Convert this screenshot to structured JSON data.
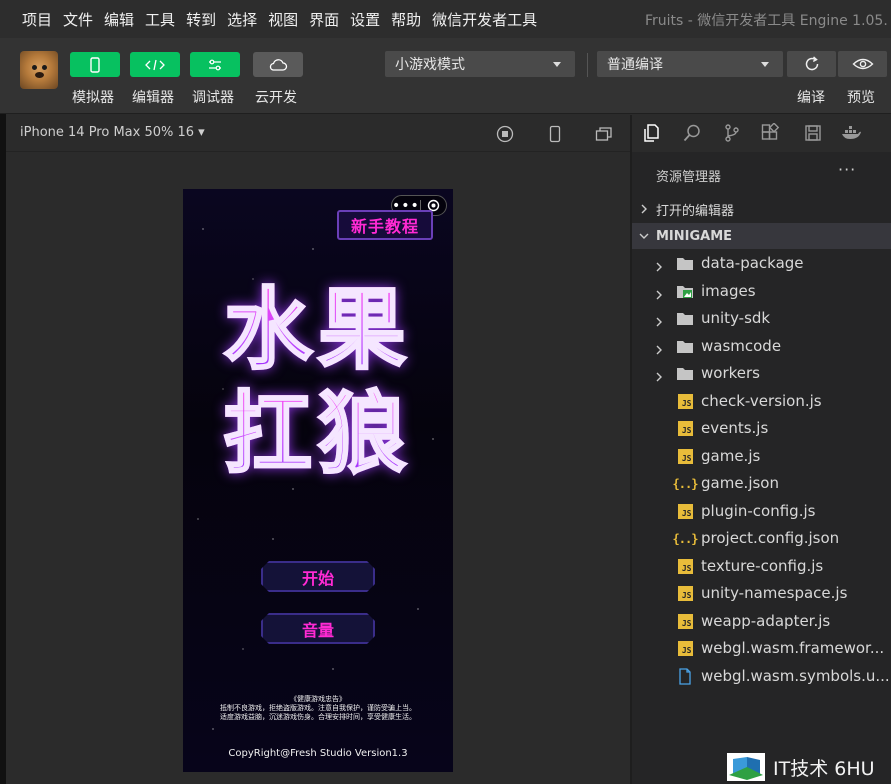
{
  "menu": [
    "项目",
    "文件",
    "编辑",
    "工具",
    "转到",
    "选择",
    "视图",
    "界面",
    "设置",
    "帮助",
    "微信开发者工具"
  ],
  "window_title": "Fruits - 微信开发者工具 Engine 1.05.",
  "toolbar": {
    "buttons": [
      {
        "label": "模拟器",
        "icon": "phone-icon"
      },
      {
        "label": "编辑器",
        "icon": "code-icon"
      },
      {
        "label": "调试器",
        "icon": "debug-icon"
      },
      {
        "label": "云开发",
        "icon": "cloud-icon"
      }
    ],
    "mode_select": "小游戏模式",
    "compile_select": "普通编译",
    "compile_label": "编译",
    "preview_label": "预览"
  },
  "simulator": {
    "device": "iPhone 14 Pro Max 50% 16 ▾"
  },
  "game": {
    "tutorial_button": "新手教程",
    "title_line_1": "水果",
    "title_line_2": "扛狼",
    "start_button": "开始",
    "volume_button": "音量",
    "health_notice_title": "《健康游戏忠告》",
    "health_notice_line_1": "抵制不良游戏，拒绝盗版游戏。注意自我保护，谨防受骗上当。",
    "health_notice_line_2": "适度游戏益脑，沉迷游戏伤身。合理安排时间，享受健康生活。",
    "copyright": "CopyRight@Fresh Studio Version1.3"
  },
  "explorer": {
    "title": "资源管理器",
    "more": "···",
    "open_editors": "打开的编辑器",
    "project": "MINIGAME",
    "items": [
      {
        "name": "data-package",
        "type": "folder"
      },
      {
        "name": "images",
        "type": "image-folder"
      },
      {
        "name": "unity-sdk",
        "type": "folder"
      },
      {
        "name": "wasmcode",
        "type": "folder"
      },
      {
        "name": "workers",
        "type": "folder"
      },
      {
        "name": "check-version.js",
        "type": "js"
      },
      {
        "name": "events.js",
        "type": "js"
      },
      {
        "name": "game.js",
        "type": "js"
      },
      {
        "name": "game.json",
        "type": "json"
      },
      {
        "name": "plugin-config.js",
        "type": "js"
      },
      {
        "name": "project.config.json",
        "type": "json"
      },
      {
        "name": "texture-config.js",
        "type": "js"
      },
      {
        "name": "unity-namespace.js",
        "type": "js"
      },
      {
        "name": "weapp-adapter.js",
        "type": "js"
      },
      {
        "name": "webgl.wasm.framewor...",
        "type": "js"
      },
      {
        "name": "webgl.wasm.symbols.u...",
        "type": "file"
      }
    ]
  },
  "watermark": "IT技术 6HU",
  "colors": {
    "accent_green": "#07c160",
    "game_magenta": "#ff2ad4",
    "game_purple": "#9a2cff",
    "js_yellow": "#e8bc3a"
  }
}
